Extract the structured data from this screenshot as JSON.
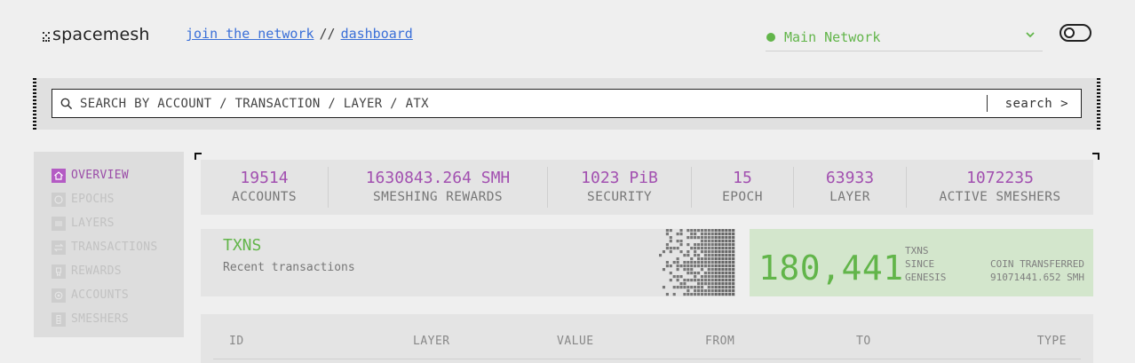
{
  "header": {
    "logo_text": "spacemesh",
    "nav": {
      "join_label": "join the network",
      "separator": "//",
      "dashboard_label": "dashboard"
    },
    "network": {
      "selected": "Main Network",
      "status_color": "#62b54a"
    }
  },
  "search": {
    "placeholder": "SEARCH BY ACCOUNT / TRANSACTION / LAYER / ATX",
    "button_label": "search >"
  },
  "sidebar": {
    "items": [
      {
        "label": "OVERVIEW",
        "icon": "home-icon",
        "active": true
      },
      {
        "label": "EPOCHS",
        "icon": "epochs-icon",
        "active": false
      },
      {
        "label": "LAYERS",
        "icon": "layers-icon",
        "active": false
      },
      {
        "label": "TRANSACTIONS",
        "icon": "transactions-icon",
        "active": false
      },
      {
        "label": "REWARDS",
        "icon": "rewards-icon",
        "active": false
      },
      {
        "label": "ACCOUNTS",
        "icon": "accounts-icon",
        "active": false
      },
      {
        "label": "SMESHERS",
        "icon": "smeshers-icon",
        "active": false
      }
    ]
  },
  "stats": [
    {
      "value": "19514",
      "label": "ACCOUNTS"
    },
    {
      "value": "1630843.264 SMH",
      "label": "SMESHING REWARDS"
    },
    {
      "value": "1023 PiB",
      "label": "SECURITY"
    },
    {
      "value": "15",
      "label": "EPOCH"
    },
    {
      "value": "63933",
      "label": "LAYER"
    },
    {
      "value": "1072235",
      "label": "ACTIVE SMESHERS"
    }
  ],
  "txns": {
    "title": "TXNS",
    "subtitle": "Recent transactions",
    "total": "180,441",
    "total_caption": [
      "TXNS",
      "SINCE",
      "GENESIS"
    ],
    "coin_caption": "COIN TRANSFERRED",
    "coin_value": "91071441.652 SMH"
  },
  "table": {
    "columns": [
      "ID",
      "LAYER",
      "VALUE",
      "FROM",
      "TO",
      "TYPE"
    ]
  },
  "colors": {
    "accent_purple": "#a250b0",
    "accent_green": "#62b54a",
    "link_blue": "#3a6fd8"
  }
}
